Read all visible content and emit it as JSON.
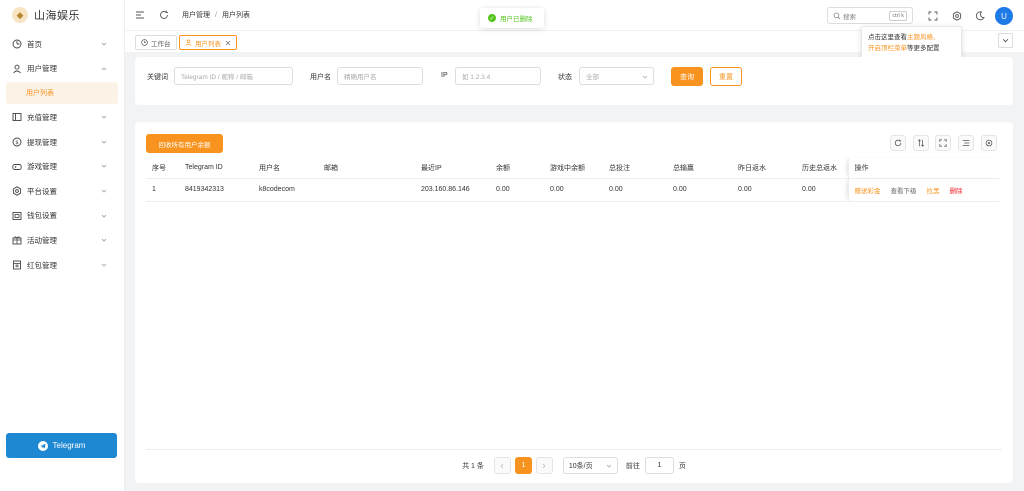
{
  "app": {
    "name": "山海娱乐"
  },
  "sidebar": {
    "items": [
      {
        "label": "首页",
        "icon": "dashboard-icon"
      },
      {
        "label": "用户管理",
        "icon": "user-icon",
        "expanded": true,
        "children": [
          {
            "label": "用户列表",
            "active": true
          }
        ]
      },
      {
        "label": "充值管理",
        "icon": "recharge-icon"
      },
      {
        "label": "提现管理",
        "icon": "withdraw-icon"
      },
      {
        "label": "游戏管理",
        "icon": "game-icon"
      },
      {
        "label": "平台设置",
        "icon": "settings-icon"
      },
      {
        "label": "钱包设置",
        "icon": "wallet-icon"
      },
      {
        "label": "活动管理",
        "icon": "gift-icon"
      },
      {
        "label": "红包管理",
        "icon": "red-packet-icon"
      }
    ],
    "telegram_button": "Telegram"
  },
  "header": {
    "breadcrumb": [
      "用户管理",
      "用户列表"
    ],
    "search_placeholder": "搜索",
    "search_shortcut": "ctrl k",
    "avatar_letter": "U"
  },
  "tabs": [
    {
      "label": "工作台",
      "active": false
    },
    {
      "label": "用户列表",
      "active": true
    }
  ],
  "toast": {
    "message": "用户已删除",
    "type": "success"
  },
  "tooltip": {
    "prefix": "点击这里查看",
    "link1": "主题风格",
    "sep": "、",
    "link2": "开启顶栏菜单",
    "suffix": "等更多配置"
  },
  "filters": {
    "keyword_label": "关键词",
    "keyword_placeholder": "Telegram ID / 昵称 / 邮箱",
    "username_label": "用户名",
    "username_placeholder": "精确用户名",
    "ip_label": "IP",
    "ip_placeholder": "如 1.2.3.4",
    "status_label": "状态",
    "status_value": "全部",
    "query_button": "查询",
    "reset_button": "重置"
  },
  "toolbar": {
    "recycle_button": "回收所有用户余额"
  },
  "table": {
    "columns": [
      "序号",
      "Telegram ID",
      "用户名",
      "邮箱",
      "最近IP",
      "余额",
      "游戏中余额",
      "总投注",
      "总输赢",
      "昨日返水",
      "历史总返水",
      "操作"
    ],
    "rows": [
      {
        "index": "1",
        "telegram_id": "8419342313",
        "username": "k8codecom",
        "email": "",
        "ip": "203.160.86.146",
        "balance": "0.00",
        "game_balance": "0.00",
        "total_bet": "0.00",
        "total_win": "0.00",
        "yesterday_rebate": "0.00",
        "total_rebate": "0.00",
        "actions": [
          "赠送彩金",
          "查看下级",
          "拉黑",
          "删除"
        ]
      }
    ]
  },
  "pagination": {
    "total_text": "共 1 条",
    "current_page": "1",
    "page_size": "10条/页",
    "jump_label": "前往",
    "jump_value": "1",
    "page_unit": "页"
  },
  "colors": {
    "accent": "#f7931e",
    "telegram": "#1e88d3",
    "danger": "#f5222d",
    "success": "#52c41a"
  }
}
